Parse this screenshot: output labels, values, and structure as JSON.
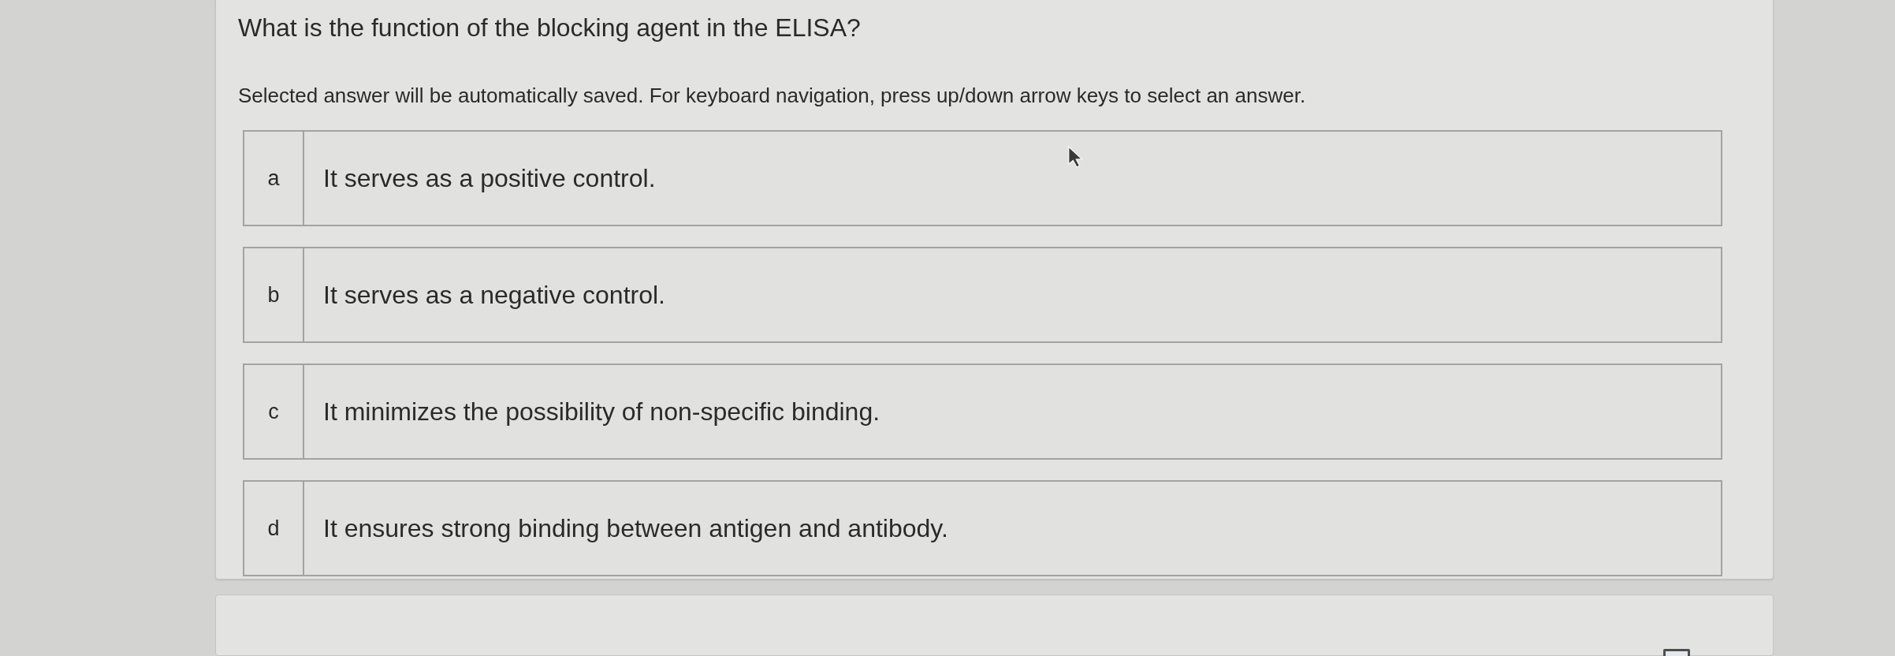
{
  "question": "What is the function of the blocking agent in the ELISA?",
  "instructions": "Selected answer will be automatically saved. For keyboard navigation, press up/down arrow keys to select an answer.",
  "options": [
    {
      "letter": "a",
      "text": "It serves as a positive control."
    },
    {
      "letter": "b",
      "text": "It serves as a negative control."
    },
    {
      "letter": "c",
      "text": "It minimizes the possibility of non-specific binding."
    },
    {
      "letter": "d",
      "text": "It ensures strong binding between antigen and antibody."
    }
  ]
}
